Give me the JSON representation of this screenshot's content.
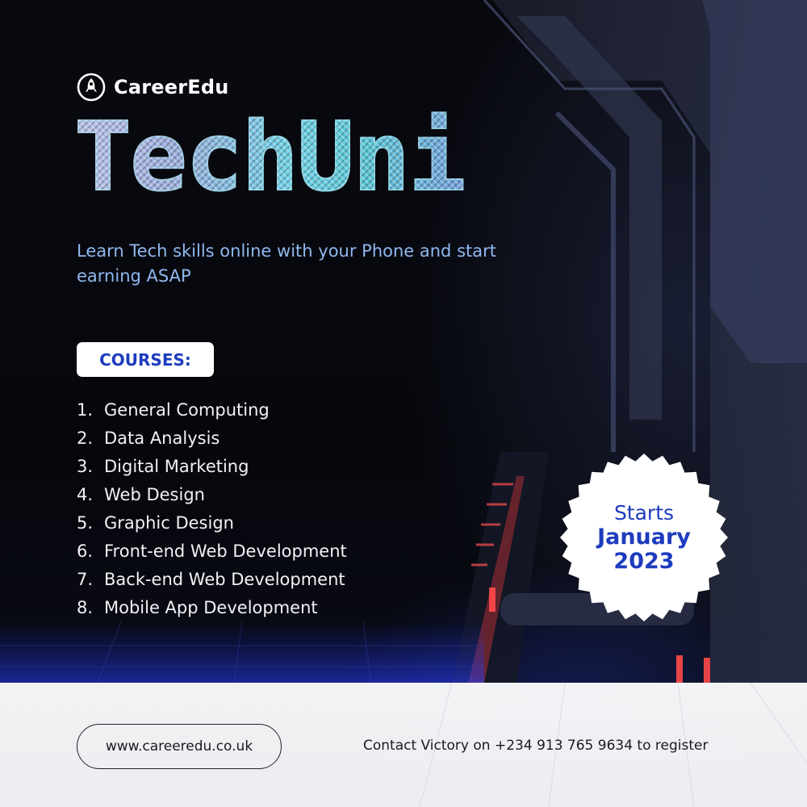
{
  "brand": {
    "name": "CareerEdu",
    "icon": "rocket-icon"
  },
  "title": "TechUni",
  "tagline": "Learn Tech skills online with your Phone and start earning ASAP",
  "courses": {
    "heading": "COURSES:",
    "items": [
      {
        "num": "1.",
        "name": "General Computing"
      },
      {
        "num": "2.",
        "name": "Data Analysis"
      },
      {
        "num": "3.",
        "name": "Digital Marketing"
      },
      {
        "num": "4.",
        "name": "Web Design"
      },
      {
        "num": "5.",
        "name": "Graphic Design"
      },
      {
        "num": "6.",
        "name": "Front-end Web Development"
      },
      {
        "num": "7.",
        "name": "Back-end Web Development"
      },
      {
        "num": "8.",
        "name": "Mobile App Development"
      }
    ]
  },
  "badge": {
    "starts": "Starts",
    "month": "January",
    "year": "2023"
  },
  "footer": {
    "website": "www.careeredu.co.uk",
    "contact": "Contact Victory on +234 913 765 9634 to register"
  },
  "colors": {
    "accent": "#1e3cbe",
    "tagline": "#8fb8ef",
    "neon_red": "#ff3b3b",
    "floor_blue": "#2a40ff"
  }
}
